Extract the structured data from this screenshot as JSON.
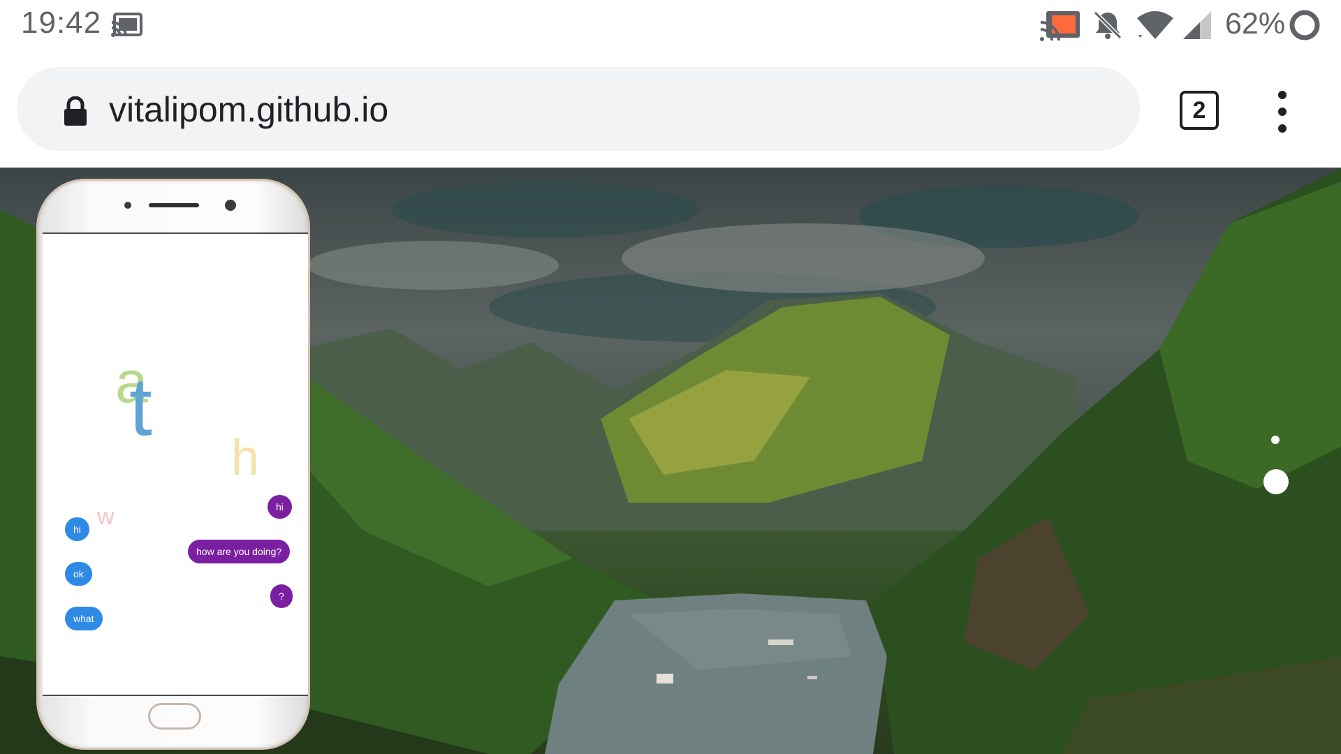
{
  "status_bar": {
    "time": "19:42",
    "battery_percent": "62%",
    "icons": [
      "cast-icon",
      "screen-cast-icon",
      "notifications-off-icon",
      "wifi-icon",
      "signal-icon",
      "battery-icon"
    ]
  },
  "browser": {
    "url": "vitalipom.github.io",
    "tab_count": "2",
    "icons": [
      "lock-icon",
      "more-vert-icon"
    ]
  },
  "phone_demo": {
    "floating_letters": [
      "a",
      "t",
      "h",
      "w"
    ],
    "messages": [
      {
        "side": "right",
        "text": "hi",
        "color": "#7b1fa2"
      },
      {
        "side": "left",
        "text": "hi",
        "color": "#2f8ae6"
      },
      {
        "side": "right",
        "text": "how are you doing?",
        "color": "#7b1fa2"
      },
      {
        "side": "left",
        "text": "ok",
        "color": "#2f8ae6"
      },
      {
        "side": "right",
        "text": "?",
        "color": "#7b1fa2"
      },
      {
        "side": "left",
        "text": "what",
        "color": "#2f8ae6"
      }
    ]
  },
  "carousel": {
    "indicator_count": 2,
    "active_index": 1
  }
}
